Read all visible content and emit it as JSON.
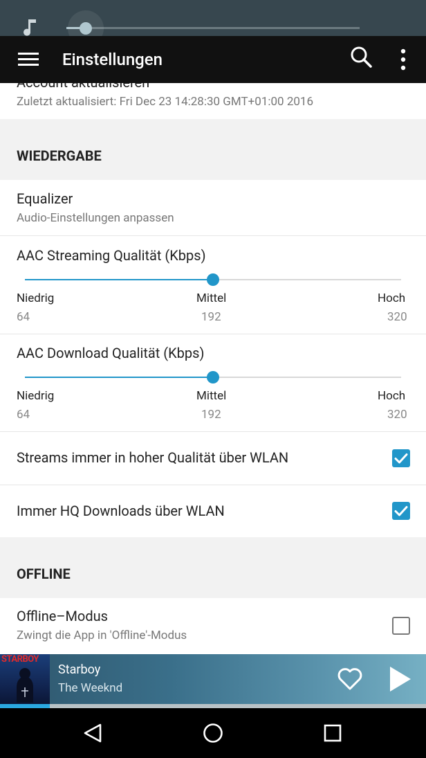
{
  "app": {
    "title": "Einstellungen"
  },
  "account": {
    "title": "Account aktualisieren",
    "subtitle": "Zuletzt aktualisiert: Fri Dec 23 14:28:30 GMT+01:00 2016"
  },
  "sections": {
    "playback": "WIEDERGABE",
    "offline": "OFFLINE"
  },
  "equalizer": {
    "title": "Equalizer",
    "subtitle": "Audio-Einstellungen anpassen"
  },
  "streaming_quality": {
    "title": "AAC Streaming Qualität (Kbps)",
    "level": 0.5,
    "low_label": "Niedrig",
    "low_value": "64",
    "mid_label": "Mittel",
    "mid_value": "192",
    "high_label": "Hoch",
    "high_value": "320"
  },
  "download_quality": {
    "title": "AAC Download Qualität (Kbps)",
    "level": 0.5,
    "low_label": "Niedrig",
    "low_value": "64",
    "mid_label": "Mittel",
    "mid_value": "192",
    "high_label": "Hoch",
    "high_value": "320"
  },
  "wifi_streams": {
    "label": "Streams immer in hoher Qualität über WLAN",
    "checked": true
  },
  "wifi_downloads": {
    "label": "Immer HQ Downloads über WLAN",
    "checked": true
  },
  "offline_mode": {
    "title": "Offline–Modus",
    "subtitle": "Zwingt die App in 'Offline'-Modus",
    "checked": false
  },
  "now_playing": {
    "song": "Starboy",
    "artist": "The Weeknd",
    "album_art_text": "STARBOY"
  },
  "colors": {
    "accent": "#2196c9",
    "appbar": "#111111",
    "statusbar": "#37474f"
  },
  "icons": {
    "status": "music-note-icon",
    "menu": "hamburger-menu-icon",
    "search": "search-icon",
    "more": "more-vert-icon",
    "heart": "heart-icon",
    "play": "play-icon",
    "back": "back-triangle-icon",
    "home": "home-circle-icon",
    "recents": "recents-square-icon"
  }
}
